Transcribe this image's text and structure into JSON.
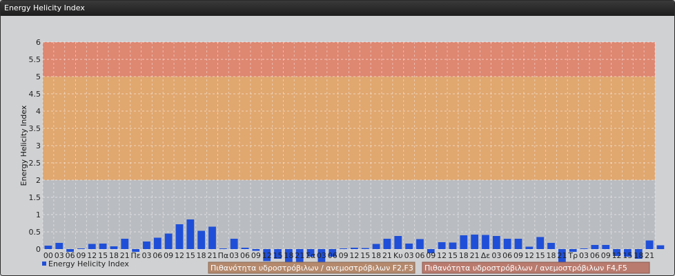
{
  "window": {
    "title": "Energy Helicity Index"
  },
  "chart_data": {
    "type": "bar",
    "title": "",
    "xlabel": "",
    "ylabel": "Energy Helicity Index",
    "ylim": [
      0,
      6
    ],
    "yticks": [
      "0",
      "0.5",
      "1",
      "1.5",
      "2",
      "2.5",
      "3",
      "3.5",
      "4",
      "4.5",
      "5",
      "5.5",
      "6"
    ],
    "grid": true,
    "legend_position": "bottom-left",
    "categories": [
      "00",
      "03",
      "06",
      "09",
      "12",
      "15",
      "18",
      "21",
      "Πε",
      "03",
      "06",
      "09",
      "12",
      "15",
      "18",
      "21",
      "Πα",
      "03",
      "06",
      "09",
      "12",
      "15",
      "18",
      "21",
      "Σα",
      "03",
      "06",
      "09",
      "12",
      "15",
      "18",
      "21",
      "Κυ",
      "03",
      "06",
      "09",
      "12",
      "15",
      "18",
      "21",
      "Δε",
      "03",
      "06",
      "09",
      "12",
      "15",
      "18",
      "21",
      "Τρ",
      "03",
      "06",
      "09",
      "12",
      "15",
      "18",
      "21"
    ],
    "series": [
      {
        "name": "Energy Helicity Index",
        "color": "#1f4fd8",
        "values": [
          0.1,
          0.18,
          -0.08,
          0.02,
          0.15,
          0.16,
          0.08,
          0.3,
          -0.08,
          0.22,
          0.33,
          0.45,
          0.72,
          0.86,
          0.53,
          0.65,
          0.02,
          0.3,
          0.04,
          -0.05,
          -0.35,
          -0.28,
          -0.45,
          -0.4,
          -0.22,
          -0.42,
          -0.22,
          0.02,
          0.04,
          0.03,
          0.15,
          0.3,
          0.38,
          0.16,
          0.29,
          -0.12,
          0.2,
          0.19,
          0.4,
          0.42,
          0.41,
          0.38,
          0.3,
          0.3,
          0.07,
          0.35,
          0.18,
          -0.45,
          -0.08,
          0.02,
          0.12,
          0.12,
          -0.2,
          -0.22,
          -0.28,
          0.25,
          0.11
        ]
      }
    ],
    "bands": [
      {
        "from": 0,
        "to": 2,
        "color": "#b9bcc1"
      },
      {
        "from": 2,
        "to": 5,
        "color": "#e0a76f"
      },
      {
        "from": 5,
        "to": 6,
        "color": "#de8771"
      }
    ],
    "legend": {
      "label": "Energy Helicity Index"
    },
    "band_legends": [
      {
        "label": "Πιθανότητα υδροστρόβιλων / ανεμοστρόβιλων F2,F3",
        "color": "#b4896c"
      },
      {
        "label": "Πιθανότητα υδροστρόβιλων / ανεμοστρόβιλων F4,F5",
        "color": "#b97b6e"
      }
    ]
  }
}
